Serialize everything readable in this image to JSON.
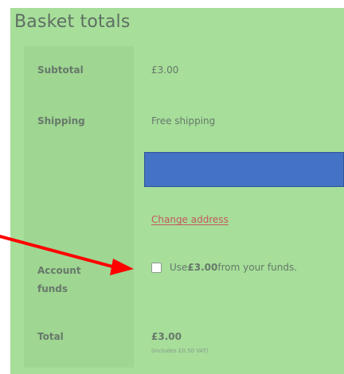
{
  "title": "Basket totals",
  "rows": {
    "subtotal": {
      "label": "Subtotal",
      "value": "£3.00"
    },
    "shipping": {
      "label": "Shipping",
      "value": "Free shipping"
    },
    "account_funds": {
      "label_line1": "Account",
      "label_line2": "funds",
      "checkbox_prefix": "Use ",
      "checkbox_amount": "£3.00",
      "checkbox_suffix": " from your funds."
    },
    "total": {
      "label": "Total",
      "value": "£3.00",
      "note": "(includes £0.50 VAT)"
    }
  },
  "links": {
    "change_address": "Change address"
  },
  "colors": {
    "background": "#a6de9a",
    "label_column": "#9ed692",
    "highlight_box": "#4472c4",
    "arrow": "#ff0000"
  },
  "icons": {
    "annotation_arrow": "red-arrow-icon"
  }
}
